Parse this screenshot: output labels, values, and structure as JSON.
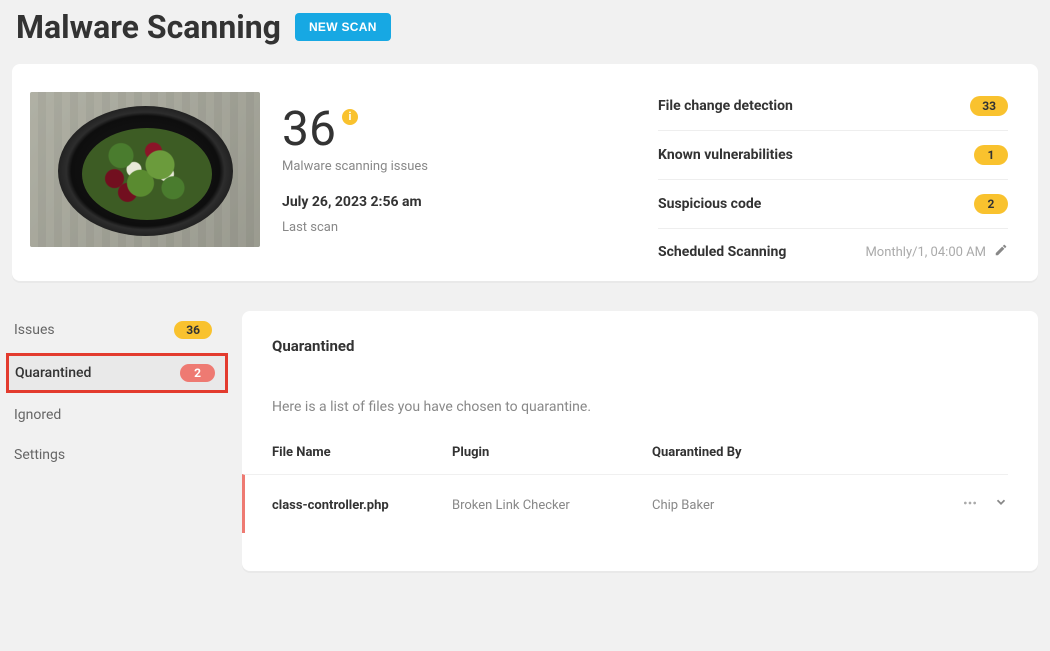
{
  "header": {
    "title": "Malware Scanning",
    "new_scan_label": "NEW SCAN"
  },
  "overview": {
    "issue_count": "36",
    "issue_label": "Malware scanning issues",
    "last_scan_date": "July 26, 2023 2:56 am",
    "last_scan_label": "Last scan",
    "info_icon_char": "i",
    "stats": [
      {
        "label": "File change detection",
        "value": "33"
      },
      {
        "label": "Known vulnerabilities",
        "value": "1"
      },
      {
        "label": "Suspicious code",
        "value": "2"
      }
    ],
    "scheduled": {
      "label": "Scheduled Scanning",
      "value": "Monthly/1, 04:00 AM"
    }
  },
  "sidebar": {
    "items": [
      {
        "label": "Issues",
        "badge": "36",
        "badge_style": "yellow"
      },
      {
        "label": "Quarantined",
        "badge": "2",
        "badge_style": "red"
      },
      {
        "label": "Ignored"
      },
      {
        "label": "Settings"
      }
    ]
  },
  "panel": {
    "title": "Quarantined",
    "description": "Here is a list of files you have chosen to quarantine.",
    "columns": {
      "file": "File Name",
      "plugin": "Plugin",
      "by": "Quarantined By"
    },
    "rows": [
      {
        "file": "class-controller.php",
        "plugin": "Broken Link Checker",
        "by": "Chip Baker"
      }
    ]
  }
}
